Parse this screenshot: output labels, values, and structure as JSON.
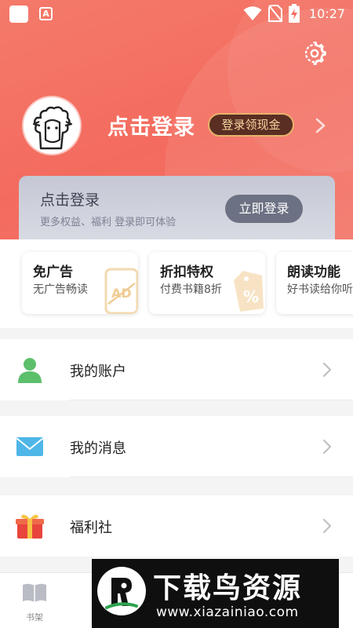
{
  "status_bar": {
    "time": "10:27",
    "notification_icon": "a-letter-icon",
    "wifi_icon": "wifi-icon",
    "signal_icon": "no-sim-icon",
    "battery_icon": "battery-charging-icon"
  },
  "header": {
    "settings_icon": "gear-icon",
    "avatar_icon": "sheep-avatar-icon",
    "login_title": "点击登录",
    "cash_badge": "登录领现金",
    "accent": "#f36b5e"
  },
  "vip_card": {
    "title": "点击登录",
    "subtitle": "更多权益、福利 登录即可体验",
    "button": "立即登录"
  },
  "perks": [
    {
      "title": "免广告",
      "subtitle": "无广告畅读",
      "icon": "ad-free-icon"
    },
    {
      "title": "折扣特权",
      "subtitle": "付费书籍8折",
      "icon": "discount-tag-icon"
    },
    {
      "title": "朗读功能",
      "subtitle": "好书读给你听",
      "icon": "audio-read-icon"
    }
  ],
  "menu": [
    {
      "label": "我的账户",
      "icon": "account-icon"
    },
    {
      "label": "我的消息",
      "icon": "message-icon"
    },
    {
      "label": "福利社",
      "icon": "gift-icon"
    }
  ],
  "tabbar": [
    {
      "label": "书架",
      "icon": "bookshelf-icon"
    }
  ],
  "watermark": {
    "title": "下载鸟资源",
    "url": "www.xiazainiao.com"
  }
}
